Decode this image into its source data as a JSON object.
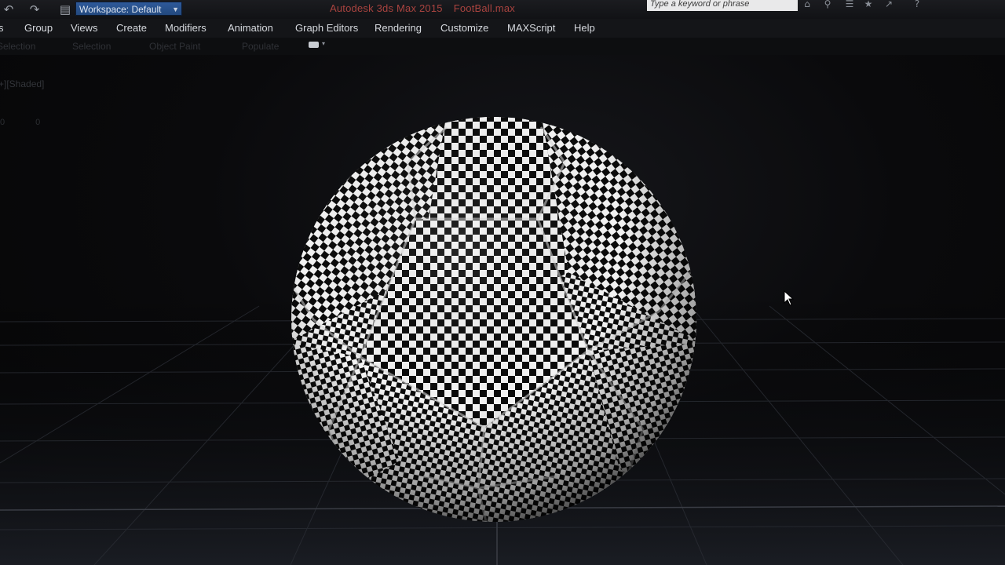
{
  "titlebar": {
    "workspace_label": "Workspace: Default",
    "app_title": "Autodesk 3ds Max  2015",
    "file_name": "FootBall.max",
    "search_placeholder": "Type a keyword or phrase",
    "title_color": "#a9433f"
  },
  "quick_access": {
    "icons": [
      "undo-icon",
      "redo-icon",
      "project-folder-icon"
    ]
  },
  "menu": {
    "items": [
      "s",
      "Group",
      "Views",
      "Create",
      "Modifiers",
      "Animation",
      "Graph Editors",
      "Rendering",
      "Customize",
      "MAXScript",
      "Help"
    ]
  },
  "ribbon": {
    "items": [
      "Selection",
      "Selection",
      "Object Paint",
      "Populate"
    ]
  },
  "viewport": {
    "label": "+][Shaded]",
    "stats": "0   0",
    "object": "soccer ball with checker texture",
    "background_color": "#0a0a0c",
    "checker_colors": [
      "#f2f2f2",
      "#0b0b0b"
    ]
  }
}
